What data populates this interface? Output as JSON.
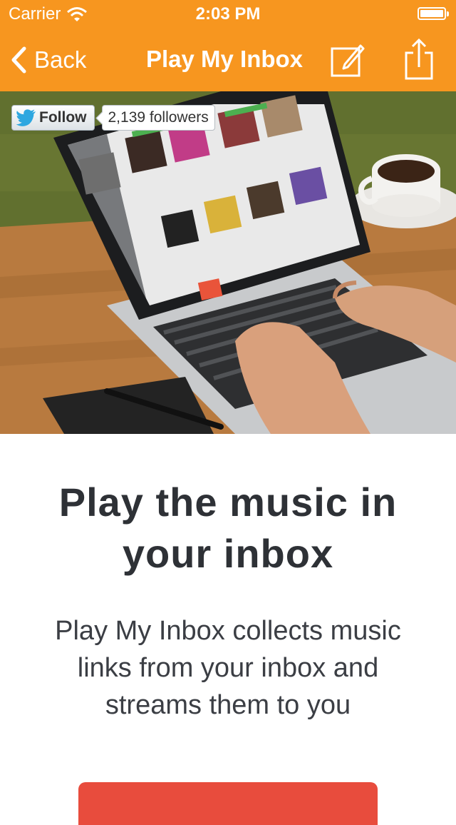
{
  "status_bar": {
    "carrier": "Carrier",
    "time": "2:03 PM"
  },
  "nav_bar": {
    "back_label": "Back",
    "title": "Play My Inbox",
    "compose_icon": "compose-icon",
    "share_icon": "share-icon"
  },
  "hero": {
    "follow_label": "Follow",
    "followers": "2,139 followers"
  },
  "content": {
    "headline_line1": "Play the music in",
    "headline_line2": "your inbox",
    "description_line1": "Play My Inbox collects music",
    "description_line2": "links from your inbox and",
    "description_line3": "streams them to you"
  },
  "colors": {
    "header": "#f7961f",
    "cta": "#e84c3d",
    "headline_text": "#2e3136"
  }
}
